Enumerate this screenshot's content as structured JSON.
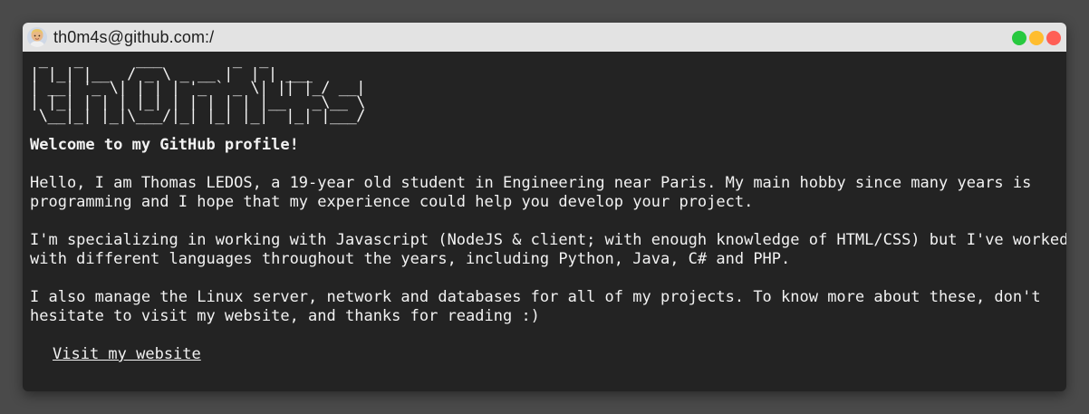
{
  "window": {
    "title": "th0m4s@github.com:/",
    "controls": [
      {
        "name": "maximize",
        "color": "#27c93f"
      },
      {
        "name": "minimize",
        "color": "#ffbd2e"
      },
      {
        "name": "close",
        "color": "#ff5f56"
      }
    ]
  },
  "terminal": {
    "ascii_art": " _   _      ___        _  _     \n| |_| |__  / _ \\ _ __ |  | | ___ \n| __| '_ \\| | | | '_ ` _ \\| || |_/ __|\n| |_| | | | |_| | | | | | |__   _\\__ \\\n \\__|_| |_|\\___/|_| |_| |_|  |_| |___/",
    "welcome": "Welcome to my GitHub profile!",
    "paragraphs": [
      "Hello, I am Thomas LEDOS, a 19-year old student in Engineering near Paris. My main hobby since many years is\nprogramming and I hope that my experience could help you develop your project.",
      "I'm specializing in working with Javascript (NodeJS & client; with enough knowledge of HTML/CSS) but I've worked\nwith different languages throughout the years, including Python, Java, C# and PHP.",
      "I also manage the Linux server, network and databases for all of my projects. To know more about these, don't\nhesitate to visit my website, and thanks for reading :)"
    ],
    "link_label": "Visit my website"
  },
  "colors": {
    "page_bg": "#4a4a4a",
    "titlebar_bg": "#e3e3e3",
    "terminal_bg": "#232323",
    "text": "#f2f2f2"
  },
  "icons": {
    "avatar": "user-avatar-icon"
  }
}
